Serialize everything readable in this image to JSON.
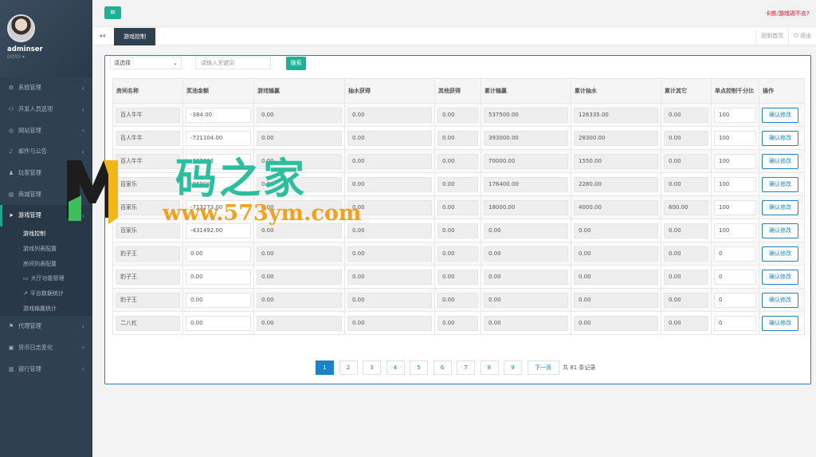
{
  "user": {
    "name": "adminser",
    "role": "DOSS ▾"
  },
  "nav": [
    {
      "label": "系统管理",
      "icon": "gears-icon",
      "glyph": "⚙"
    },
    {
      "label": "开发人员选项",
      "icon": "gamepad-icon",
      "glyph": "⚇"
    },
    {
      "label": "网站管理",
      "icon": "globe-icon",
      "glyph": "◎"
    },
    {
      "label": "邮件与公告",
      "icon": "bell-icon",
      "glyph": "♪"
    },
    {
      "label": "玩家管理",
      "icon": "user-icon",
      "glyph": "♟"
    },
    {
      "label": "商城管理",
      "icon": "shop-icon",
      "glyph": "▤"
    },
    {
      "label": "游戏管理",
      "icon": "send-icon",
      "glyph": "➤"
    }
  ],
  "subnav": [
    {
      "label": "游戏控制",
      "glyph": ""
    },
    {
      "label": "游戏列表配置",
      "glyph": ""
    },
    {
      "label": "房间列表配置",
      "glyph": ""
    },
    {
      "label": "大厅功能管理",
      "glyph": "▭"
    },
    {
      "label": "平台数据统计",
      "glyph": "↗"
    },
    {
      "label": "游戏输赢统计",
      "glyph": ""
    }
  ],
  "nav_bottom": [
    {
      "label": "代理管理",
      "icon": "agent-icon",
      "glyph": "⚑"
    },
    {
      "label": "货币日志变化",
      "icon": "money-icon",
      "glyph": "▣"
    },
    {
      "label": "银行管理",
      "icon": "bank-icon",
      "glyph": "▥"
    }
  ],
  "topbar": {
    "menu_icon": "≡",
    "link": "卡房/游戏进不去?"
  },
  "tabs": {
    "back": "◂◂",
    "active": "游戏控制",
    "refresh": "回到首页",
    "logout": "⏻ 退出"
  },
  "filter": {
    "select": "请选择",
    "placeholder": "请输入关键词",
    "search": "搜索"
  },
  "table": {
    "headers": [
      "房间名称",
      "奖池金额",
      "游戏输赢",
      "抽水获得",
      "其他获得",
      "累计输赢",
      "累计抽水",
      "累计其它",
      "单点控制千分比",
      "操作"
    ],
    "rows": [
      [
        "百人牛牛",
        "-384.00",
        "0.00",
        "0.00",
        "0.00",
        "537500.00",
        "126335.00",
        "0.00",
        "100"
      ],
      [
        "百人牛牛",
        "-721104.00",
        "0.00",
        "0.00",
        "0.00",
        "393000.00",
        "28300.00",
        "0.00",
        "100"
      ],
      [
        "百人牛牛",
        "-382912",
        "0.00",
        "0.00",
        "0.00",
        "70000.00",
        "1550.00",
        "0.00",
        "100"
      ],
      [
        "百家乐",
        "-86900",
        "0.00",
        "0.00",
        "0.00",
        "176400.00",
        "2280.00",
        "0.00",
        "100"
      ],
      [
        "百家乐",
        "-713273.00",
        "0.00",
        "0.00",
        "0.00",
        "18000.00",
        "4000.00",
        "600.00",
        "100"
      ],
      [
        "百家乐",
        "-431492.00",
        "0.00",
        "0.00",
        "0.00",
        "0.00",
        "0.00",
        "0.00",
        "100"
      ],
      [
        "豹子王",
        "0.00",
        "0.00",
        "0.00",
        "0.00",
        "0.00",
        "0.00",
        "0.00",
        "0"
      ],
      [
        "豹子王",
        "0.00",
        "0.00",
        "0.00",
        "0.00",
        "0.00",
        "0.00",
        "0.00",
        "0"
      ],
      [
        "豹子王",
        "0.00",
        "0.00",
        "0.00",
        "0.00",
        "0.00",
        "0.00",
        "0.00",
        "0"
      ],
      [
        "二八杠",
        "0.00",
        "0.00",
        "0.00",
        "0.00",
        "0.00",
        "0.00",
        "0.00",
        "0"
      ]
    ],
    "action": "确认修改"
  },
  "pager": {
    "pages": [
      "1",
      "2",
      "3",
      "4",
      "5",
      "6",
      "7",
      "8",
      "9"
    ],
    "next": "下一页",
    "total": "共 81 条记录"
  },
  "watermark": {
    "cn": "码之家",
    "url": "www.573ym.com"
  }
}
